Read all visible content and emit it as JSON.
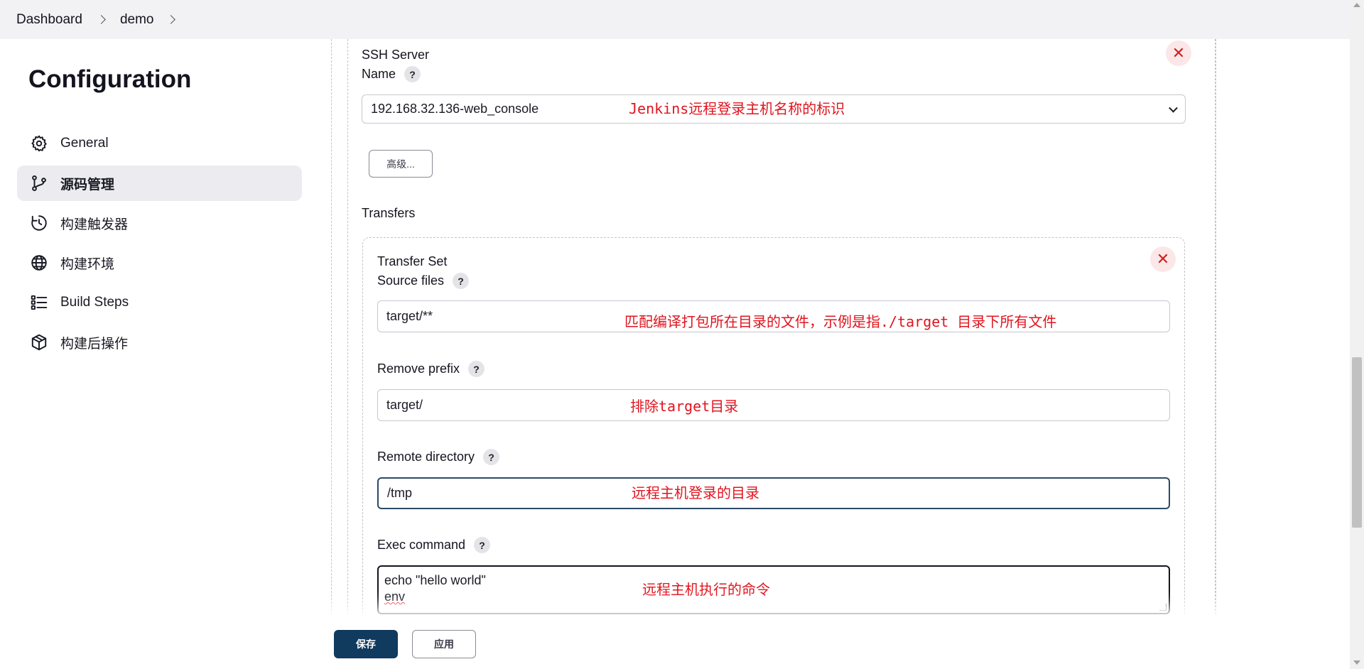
{
  "breadcrumb": {
    "items": [
      "Dashboard",
      "demo"
    ]
  },
  "page": {
    "title": "Configuration"
  },
  "sidebar": {
    "items": [
      {
        "label": "General",
        "icon": "gear-icon"
      },
      {
        "label": "源码管理",
        "icon": "branch-icon",
        "active": true
      },
      {
        "label": "构建触发器",
        "icon": "clock-icon"
      },
      {
        "label": "构建环境",
        "icon": "globe-icon"
      },
      {
        "label": "Build Steps",
        "icon": "list-icon"
      },
      {
        "label": "构建后操作",
        "icon": "package-icon"
      }
    ]
  },
  "ssh_server": {
    "section_label": "SSH Server",
    "name_label": "Name",
    "name_value": "192.168.32.136-web_console",
    "advanced_button": "高级...",
    "transfers_label": "Transfers"
  },
  "transfer_set": {
    "title": "Transfer Set",
    "source_files_label": "Source files",
    "source_files_value": "target/**",
    "remove_prefix_label": "Remove prefix",
    "remove_prefix_value": "target/",
    "remote_directory_label": "Remote directory",
    "remote_directory_value": "/tmp",
    "exec_command_label": "Exec command",
    "exec_command_lines": [
      "echo \"hello world\"",
      "env"
    ]
  },
  "annotations": {
    "name": "Jenkins远程登录主机名称的标识",
    "source_files": "匹配编译打包所在目录的文件，示例是指./target 目录下所有文件",
    "remove_prefix": "排除target目录",
    "remote_directory": "远程主机登录的目录",
    "exec_command": "远程主机执行的命令"
  },
  "actions": {
    "save": "保存",
    "apply": "应用"
  },
  "colors": {
    "accent": "#103a5e",
    "annotation": "#e0141e",
    "close": "#d11f1f"
  }
}
